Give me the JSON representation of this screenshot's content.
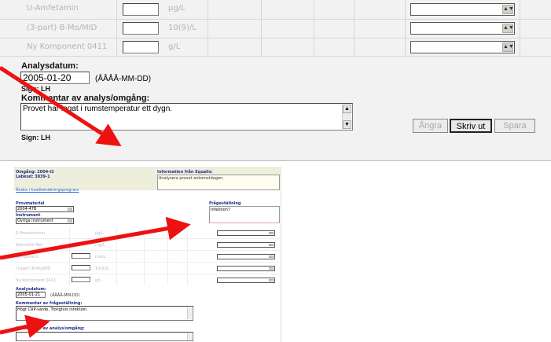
{
  "top": {
    "rows": [
      {
        "name": "U-Amfetamin",
        "unit": "µg/L"
      },
      {
        "name": "(3-part) B-Mo/MID",
        "unit": "10(9)/L"
      },
      {
        "name": "Ny Komponent 0411",
        "unit": "g/L"
      }
    ],
    "analysis_date_label": "Analysdatum:",
    "analysis_date_value": "2005-01-20",
    "date_format": "(ÅÅÅÅ-MM-DD)",
    "sign1": "Sign: LH",
    "comment_label": "Kommentar av analys/omgång:",
    "comment_text": "Provet har legat i rumstemperatur ett dygn.",
    "sign2": "Sign: LH",
    "buttons": {
      "undo": "Ångra",
      "print": "Skriv ut",
      "save": "Spara"
    }
  },
  "thumb": {
    "omgang": "Omgång: 2004-I2",
    "labkod": "Labkod: 3839-1",
    "info_label": "Information från Equalis:",
    "info_text": "Analysera provet ankomstdagen.",
    "change_link": "Ändra i kvalitetsäkringsprogram",
    "provmaterial_label": "Provmaterial",
    "provmaterial_value": "2004-47B",
    "instrument_label": "Instrument",
    "instrument_value": "Övriga instrument",
    "question_label": "Frågeställning",
    "question_value": "Infektion?",
    "rows": [
      {
        "name": "S-Procalcitonin",
        "unit": "µg/L"
      },
      {
        "name": "Alfentanil-Ref",
        "unit": "mg/L"
      },
      {
        "name": "Komponent",
        "unit": "mol/L"
      },
      {
        "name": "(3-part) B-Mo/MID",
        "unit": "10(9)/L"
      },
      {
        "name": "Ny Komponent 0411",
        "unit": "g/L"
      }
    ],
    "analysis_date_label": "Analysdatum:",
    "analysis_date_value": "2005-01-21",
    "date_format": "(ÅÅÅÅ-MM-DD)",
    "question_comment_label": "Kommentar av frågeställning:",
    "question_comment_text": "Högt CRP-värde. Troligtvis infektion.",
    "run_comment_label": "Kommentar av analys/omgång:"
  },
  "colors": {
    "arrow": "#ee1111",
    "label": "#1f2f8a",
    "thumb_header": "#eeeedd",
    "thumb_info": "#fff8d8"
  }
}
